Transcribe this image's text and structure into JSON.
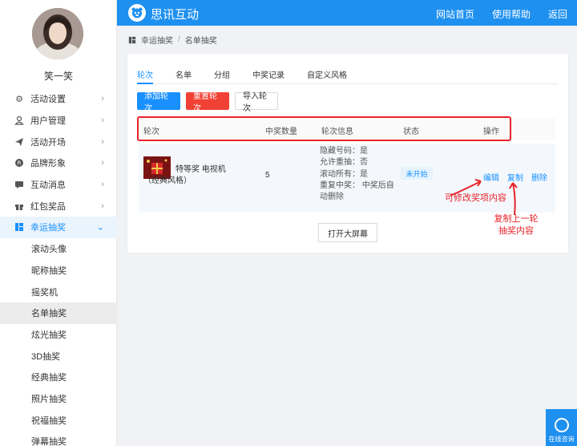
{
  "user": {
    "name": "笑一笑"
  },
  "sidebar": {
    "items": [
      {
        "label": "活动设置",
        "icon": "gear-icon"
      },
      {
        "label": "用户管理",
        "icon": "user-group-icon"
      },
      {
        "label": "活动开场",
        "icon": "paper-plane-icon"
      },
      {
        "label": "品牌形象",
        "icon": "registered-icon"
      },
      {
        "label": "互动消息",
        "icon": "chat-bubble-icon"
      },
      {
        "label": "红包奖品",
        "icon": "gift-icon"
      },
      {
        "label": "幸运抽奖",
        "icon": "lottery-icon"
      }
    ],
    "sub_items": [
      {
        "label": "滚动头像"
      },
      {
        "label": "昵称抽奖"
      },
      {
        "label": "摇奖机"
      },
      {
        "label": "名单抽奖"
      },
      {
        "label": "炫光抽奖"
      },
      {
        "label": "3D抽奖"
      },
      {
        "label": "经典抽奖"
      },
      {
        "label": "照片抽奖"
      },
      {
        "label": "祝福抽奖"
      },
      {
        "label": "弹幕抽奖"
      }
    ]
  },
  "header": {
    "brand": "思讯互动",
    "nav": [
      "网站首页",
      "使用帮助",
      "返回"
    ]
  },
  "breadcrumb": {
    "parent": "幸运抽奖",
    "current": "名单抽奖"
  },
  "tabs": [
    "轮次",
    "名单",
    "分组",
    "中奖记录",
    "自定义风格"
  ],
  "buttons": {
    "add": "添加轮次",
    "reset": "重置轮次",
    "import": "导入轮次",
    "big_screen": "打开大屏幕"
  },
  "table": {
    "headers": [
      "轮次",
      "中奖数量",
      "轮次信息",
      "状态",
      "操作"
    ],
    "rows": [
      {
        "prize": "特等奖 电视机（经典风格）",
        "count": "5",
        "info": [
          "隐藏号码：是",
          "允许重抽：否",
          "滚动所有：是",
          "重复中奖：",
          "中奖后自动删除"
        ],
        "status": "未开始",
        "ops": [
          "编辑",
          "复制",
          "删除"
        ]
      }
    ]
  },
  "annotations": {
    "edit_note": "可修改奖项内容",
    "copy_note_line1": "复制上一轮",
    "copy_note_line2": "抽奖内容"
  },
  "chat": {
    "label": "在线咨询"
  },
  "colors": {
    "primary": "#1e90f0",
    "danger": "#f04134",
    "annotation": "#e8232a"
  }
}
